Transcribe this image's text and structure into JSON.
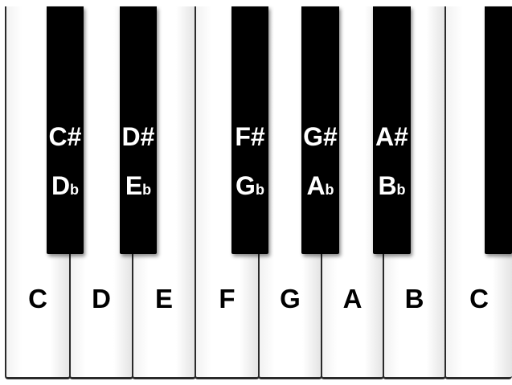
{
  "white_keys": [
    {
      "label": "C"
    },
    {
      "label": "D"
    },
    {
      "label": "E"
    },
    {
      "label": "F"
    },
    {
      "label": "G"
    },
    {
      "label": "A"
    },
    {
      "label": "B"
    },
    {
      "label": "C"
    }
  ],
  "black_keys": [
    {
      "sharp": "C#",
      "flat_letter": "D",
      "flat_sign": "b"
    },
    {
      "sharp": "D#",
      "flat_letter": "E",
      "flat_sign": "b"
    },
    {
      "sharp": "F#",
      "flat_letter": "G",
      "flat_sign": "b"
    },
    {
      "sharp": "G#",
      "flat_letter": "A",
      "flat_sign": "b"
    },
    {
      "sharp": "A#",
      "flat_letter": "B",
      "flat_sign": "b"
    },
    {
      "sharp": "",
      "flat_letter": "",
      "flat_sign": ""
    }
  ],
  "colors": {
    "white_key": "#ffffff",
    "black_key": "#000000",
    "label_on_white": "#000000",
    "label_on_black": "#ffffff"
  }
}
